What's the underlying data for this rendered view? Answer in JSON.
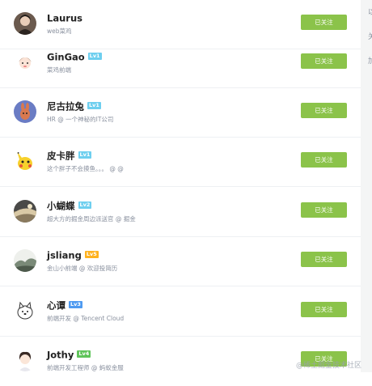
{
  "follow_label": "已关注",
  "colors": {
    "accent": "#8bc34a",
    "lv1": "#6ecfef",
    "lv2": "#6ecfef",
    "lv3": "#4e9af1",
    "lv5": "#ffb21e",
    "lv4": "#5fc45a"
  },
  "users": [
    {
      "name": "Laurus",
      "level": "",
      "desc": "web菜鸡",
      "avatar": "photo-avatar"
    },
    {
      "name": "GinGao",
      "level": "Lv1",
      "desc": "菜鸡前端",
      "avatar": "girl-avatar"
    },
    {
      "name": "尼古拉兔",
      "level": "Lv1",
      "desc": "HR @ 一个神秘的IT公司",
      "avatar": "rabbit-avatar"
    },
    {
      "name": "皮卡胖",
      "level": "Lv1",
      "desc": "这个胖子不会摸鱼。。。 @ @",
      "avatar": "pikachu-avatar"
    },
    {
      "name": "小蝴蝶",
      "level": "Lv2",
      "desc": "超大方的掘金周边派送官 @ 掘金",
      "avatar": "landscape-avatar"
    },
    {
      "name": "jsliang",
      "level": "Lv5",
      "desc": "金山小前端 @ 欢迎投简历",
      "avatar": "ink-avatar"
    },
    {
      "name": "心谭",
      "level": "Lv3",
      "desc": "前端开发 @ Tencent Cloud",
      "avatar": "dog-avatar"
    },
    {
      "name": "Jothy",
      "level": "Lv4",
      "desc": "前端开发工程师 @ 蚂蚁金服",
      "avatar": "anime-avatar"
    }
  ],
  "right_edge_chars": [
    "以",
    "关",
    "加"
  ],
  "watermark": "@稀土掘金技术社区"
}
